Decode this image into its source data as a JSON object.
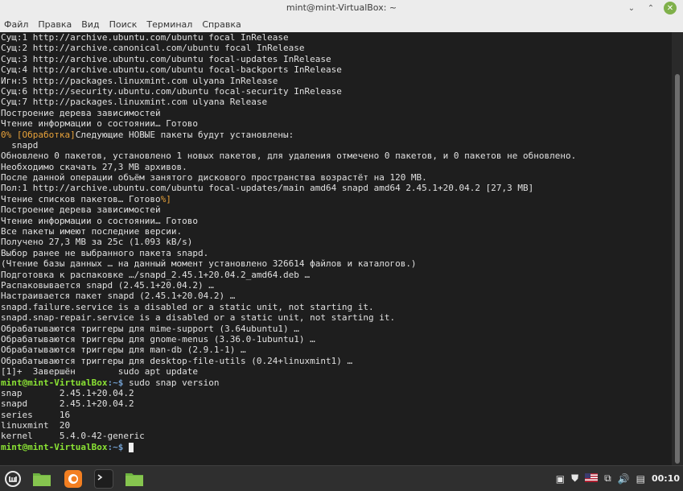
{
  "window": {
    "title": "mint@mint-VirtualBox: ~"
  },
  "menu": [
    "Файл",
    "Правка",
    "Вид",
    "Поиск",
    "Терминал",
    "Справка"
  ],
  "terminal": {
    "lines": [
      "Сущ:1 http://archive.ubuntu.com/ubuntu focal InRelease",
      "Сущ:2 http://archive.canonical.com/ubuntu focal InRelease",
      "Сущ:3 http://archive.ubuntu.com/ubuntu focal-updates InRelease",
      "Сущ:4 http://archive.ubuntu.com/ubuntu focal-backports InRelease",
      "Игн:5 http://packages.linuxmint.com ulyana InRelease",
      "Сущ:6 http://security.ubuntu.com/ubuntu focal-security InRelease",
      "Сущ:7 http://packages.linuxmint.com ulyana Release",
      "Построение дерева зависимостей",
      "Чтение информации о состоянии… Готово",
      "Следующие НОВЫЕ пакеты будут установлены:",
      "  snapd",
      "Обновлено 0 пакетов, установлено 1 новых пакетов, для удаления отмечено 0 пакетов, и 0 пакетов не обновлено.",
      "Необходимо скачать 27,3 MB архивов.",
      "После данной операции объём занятого дискового пространства возрастёт на 120 MB.",
      "Пол:1 http://archive.ubuntu.com/ubuntu focal-updates/main amd64 snapd amd64 2.45.1+20.04.2 [27,3 MB]",
      "Чтение списков пакетов… Готово",
      "Построение дерева зависимостей",
      "Чтение информации о состоянии… Готово",
      "Все пакеты имеют последние версии.",
      "Получено 27,3 MB за 25c (1.093 kB/s)",
      "Выбор ранее не выбранного пакета snapd.",
      "(Чтение базы данных … на данный момент установлено 326614 файлов и каталогов.)",
      "Подготовка к распаковке …/snapd_2.45.1+20.04.2_amd64.deb …",
      "Распаковывается snapd (2.45.1+20.04.2) …",
      "Настраивается пакет snapd (2.45.1+20.04.2) …",
      "snapd.failure.service is a disabled or a static unit, not starting it.",
      "snapd.snap-repair.service is a disabled or a static unit, not starting it.",
      "Обрабатываются триггеры для mime-support (3.64ubuntu1) …",
      "Обрабатываются триггеры для gnome-menus (3.36.0-1ubuntu1) …",
      "Обрабатываются триггеры для man-db (2.9.1-1) …",
      "Обрабатываются триггеры для desktop-file-utils (0.24+linuxmint1) …",
      "[1]+  Завершён        sudo apt update",
      "",
      "snap       2.45.1+20.04.2",
      "snapd      2.45.1+20.04.2",
      "series     16",
      "linuxmint  20",
      "kernel     5.4.0-42-generic",
      ""
    ],
    "progress_prefix": "0% [Обработка]",
    "progress_suffix": "%]",
    "prompt_user": "mint@mint-VirtualBox",
    "prompt_path": ":~$",
    "command": " sudo snap version"
  },
  "taskbar": {
    "icons": [
      "mint-menu-icon",
      "folder-icon",
      "firefox-icon",
      "terminal-icon",
      "folder-icon"
    ],
    "clock": "00:10"
  }
}
